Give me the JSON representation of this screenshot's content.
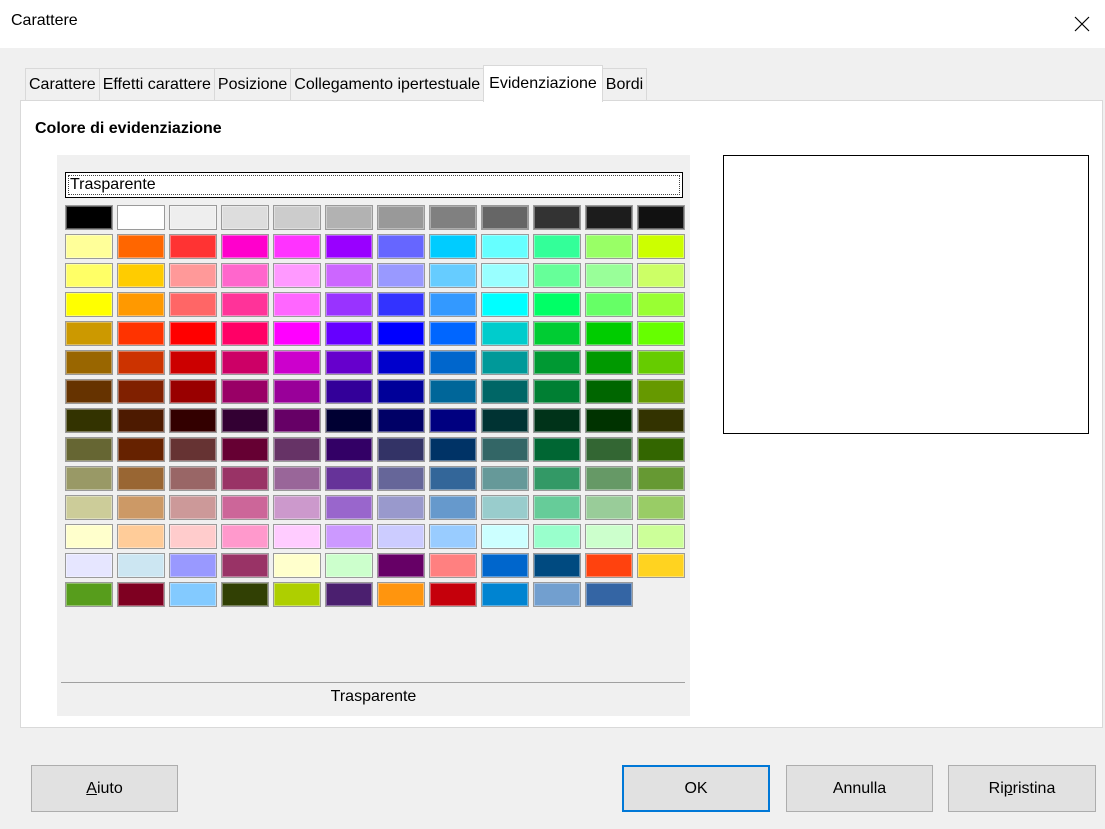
{
  "window": {
    "title": "Carattere",
    "close_icon": "close-icon"
  },
  "tabs": [
    {
      "label": "Carattere",
      "active": false
    },
    {
      "label": "Effetti carattere",
      "active": false
    },
    {
      "label": "Posizione",
      "active": false
    },
    {
      "label": "Collegamento ipertestuale",
      "active": false
    },
    {
      "label": "Evidenziazione",
      "active": true
    },
    {
      "label": "Bordi",
      "active": false
    }
  ],
  "highlight": {
    "section_title": "Colore di evidenziazione",
    "transparent_button": "Trasparente",
    "selected_color_label": "Trasparente"
  },
  "palette": [
    [
      "#000000",
      "#ffffff",
      "#eeeeee",
      "#dddddd",
      "#cccccc",
      "#b2b2b2",
      "#999999",
      "#808080",
      "#666666",
      "#333333",
      "#1c1c1c",
      "#111111"
    ],
    [
      "#ffff99",
      "#ff6600",
      "#ff3333",
      "#ff00cc",
      "#ff33ff",
      "#9900ff",
      "#6666ff",
      "#00ccff",
      "#66ffff",
      "#33ff99",
      "#99ff66",
      "#ccff00"
    ],
    [
      "#ffff66",
      "#ffcc00",
      "#ff9999",
      "#ff66cc",
      "#ff99ff",
      "#cc66ff",
      "#9999ff",
      "#66ccff",
      "#99ffff",
      "#66ff99",
      "#99ff99",
      "#ccff66"
    ],
    [
      "#ffff00",
      "#ff9900",
      "#ff6666",
      "#ff3399",
      "#ff66ff",
      "#9933ff",
      "#3333ff",
      "#3399ff",
      "#00ffff",
      "#00ff66",
      "#66ff66",
      "#99ff33"
    ],
    [
      "#cc9900",
      "#ff3300",
      "#ff0000",
      "#ff0066",
      "#ff00ff",
      "#6600ff",
      "#0000ff",
      "#0066ff",
      "#00cccc",
      "#00cc33",
      "#00cc00",
      "#66ff00"
    ],
    [
      "#996600",
      "#cc3300",
      "#cc0000",
      "#cc0066",
      "#cc00cc",
      "#6600cc",
      "#0000cc",
      "#0066cc",
      "#009999",
      "#009933",
      "#009900",
      "#66cc00"
    ],
    [
      "#663300",
      "#802000",
      "#990000",
      "#990066",
      "#990099",
      "#330099",
      "#000099",
      "#006699",
      "#006666",
      "#007f33",
      "#006600",
      "#669900"
    ],
    [
      "#333300",
      "#4d1a00",
      "#330000",
      "#330033",
      "#660066",
      "#000033",
      "#000066",
      "#000080",
      "#003333",
      "#003319",
      "#003300",
      "#333300"
    ],
    [
      "#666633",
      "#662200",
      "#663333",
      "#660033",
      "#663366",
      "#330066",
      "#333366",
      "#003366",
      "#336666",
      "#006633",
      "#336633",
      "#336600"
    ],
    [
      "#999966",
      "#996633",
      "#996666",
      "#993366",
      "#996699",
      "#663399",
      "#666699",
      "#336699",
      "#669999",
      "#339966",
      "#669966",
      "#669933"
    ],
    [
      "#cccc99",
      "#cc9966",
      "#cc9999",
      "#cc6699",
      "#cc99cc",
      "#9966cc",
      "#9999cc",
      "#6699cc",
      "#99cccc",
      "#66cc99",
      "#99cc99",
      "#99cc66"
    ],
    [
      "#ffffcc",
      "#ffcc99",
      "#ffcccc",
      "#ff99cc",
      "#ffccff",
      "#cc99ff",
      "#ccccff",
      "#99ccff",
      "#ccffff",
      "#99ffcc",
      "#ccffcc",
      "#ccff99"
    ],
    [
      "#e6e6ff",
      "#cce6f2",
      "#9999ff",
      "#993366",
      "#ffffcc",
      "#ccffcc",
      "#660066",
      "#ff8080",
      "#0066cc",
      "#004a80",
      "#ff420e",
      "#ffd320"
    ],
    [
      "#579d1c",
      "#7e0021",
      "#83caff",
      "#314004",
      "#aecf00",
      "#4b1f6f",
      "#ff950e",
      "#c5000b",
      "#0084d1",
      "#729fcf",
      "#3465a4"
    ]
  ],
  "buttons": {
    "help": "Aiuto",
    "ok": "OK",
    "cancel": "Annulla",
    "reset_prefix": "Ri",
    "reset_underline": "p",
    "reset_suffix": "ristina",
    "help_underline": "A",
    "help_suffix": "iuto"
  }
}
